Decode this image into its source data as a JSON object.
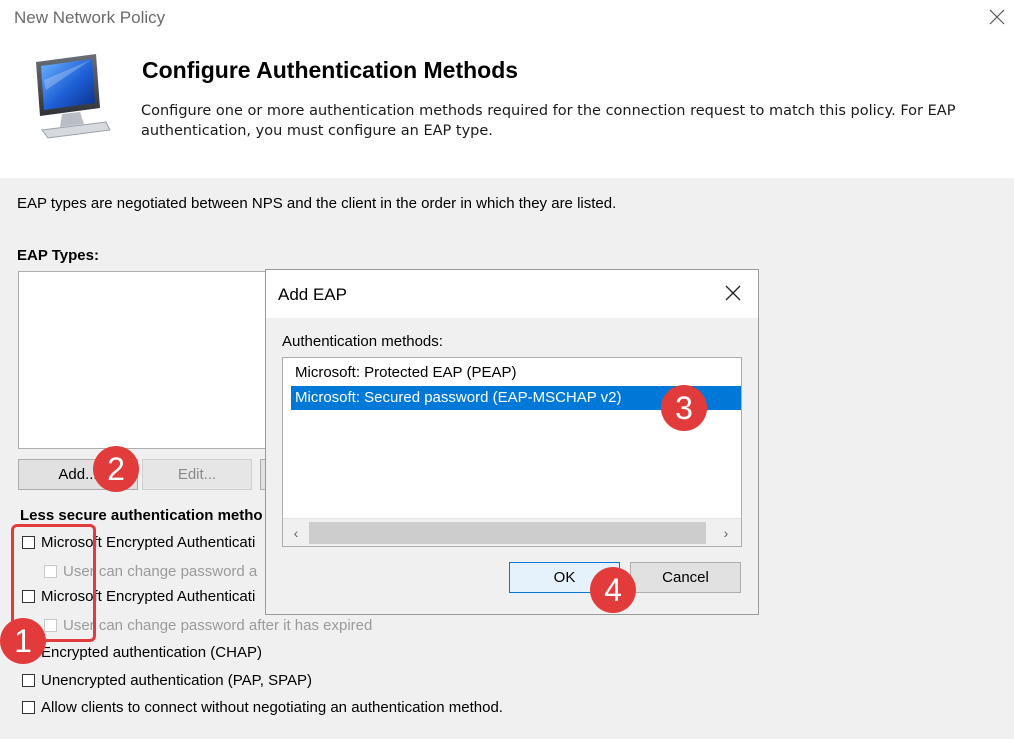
{
  "window": {
    "title": "New Network Policy"
  },
  "header": {
    "title": "Configure Authentication Methods",
    "description": "Configure one or more authentication methods required for the connection request to match this policy. For EAP authentication, you must configure an EAP type."
  },
  "panel": {
    "note": "EAP types are negotiated between NPS and the client in the order in which they are listed.",
    "eap_types_label": "EAP Types:",
    "add_label": "Add...",
    "edit_label": "Edit...",
    "less_secure_label": "Less secure authentication metho",
    "checkboxes": [
      {
        "label": "Microsoft Encrypted Authenticati",
        "checked": false,
        "disabled": false
      },
      {
        "label": "User can change password a",
        "checked": false,
        "disabled": true
      },
      {
        "label": "Microsoft Encrypted Authenticati",
        "checked": false,
        "disabled": false
      },
      {
        "label": "User can change password after it has expired",
        "checked": false,
        "disabled": true
      },
      {
        "label": "Encrypted authentication (CHAP)",
        "checked": false,
        "disabled": false
      },
      {
        "label": "Unencrypted authentication (PAP, SPAP)",
        "checked": false,
        "disabled": false
      },
      {
        "label": "Allow clients to connect without negotiating an authentication method.",
        "checked": false,
        "disabled": false
      }
    ]
  },
  "dialog": {
    "title": "Add EAP",
    "methods_label": "Authentication methods:",
    "methods": [
      {
        "label": "Microsoft: Protected EAP (PEAP)",
        "selected": false
      },
      {
        "label": "Microsoft: Secured password (EAP-MSCHAP v2)",
        "selected": true
      }
    ],
    "ok_label": "OK",
    "cancel_label": "Cancel"
  },
  "annotations": {
    "badges": [
      "1",
      "2",
      "3",
      "4"
    ],
    "color": "#e23b3b"
  },
  "colors": {
    "selection": "#0078d7",
    "panel": "#f0f0f0"
  }
}
